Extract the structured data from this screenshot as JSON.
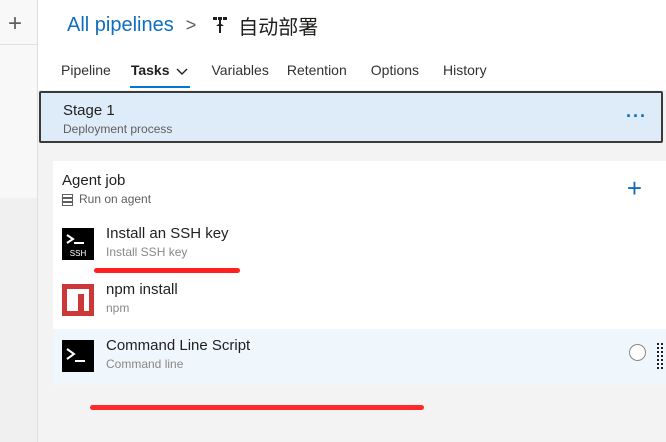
{
  "breadcrumb": {
    "root": "All pipelines",
    "separator": ">",
    "pipeline_icon": "pipeline-icon",
    "title": "自动部署"
  },
  "tabs": [
    {
      "label": "Pipeline",
      "active": false
    },
    {
      "label": "Tasks",
      "active": true,
      "has_dropdown": true
    },
    {
      "label": "Variables",
      "active": false
    },
    {
      "label": "Retention",
      "active": false
    },
    {
      "label": "Options",
      "active": false
    },
    {
      "label": "History",
      "active": false
    }
  ],
  "stage": {
    "name": "Stage 1",
    "subtitle": "Deployment process",
    "more": "···"
  },
  "job": {
    "title": "Agent job",
    "subtitle": "Run on agent",
    "icon": "server-icon",
    "add": "+"
  },
  "tasks": [
    {
      "name": "Install an SSH key",
      "subtitle": "Install SSH key",
      "icon": "ssh-terminal-icon",
      "badge": "SSH"
    },
    {
      "name": "npm install",
      "subtitle": "npm",
      "icon": "npm-icon"
    },
    {
      "name": "Command Line Script",
      "subtitle": "Command line",
      "icon": "terminal-icon",
      "selected": true
    }
  ],
  "rail": {
    "add": "+"
  },
  "colors": {
    "accent": "#0078d4",
    "link": "#106ebe",
    "stage_bg": "#deecf9",
    "annotation_red": "#ff2020",
    "npm_red": "#cb3837"
  }
}
